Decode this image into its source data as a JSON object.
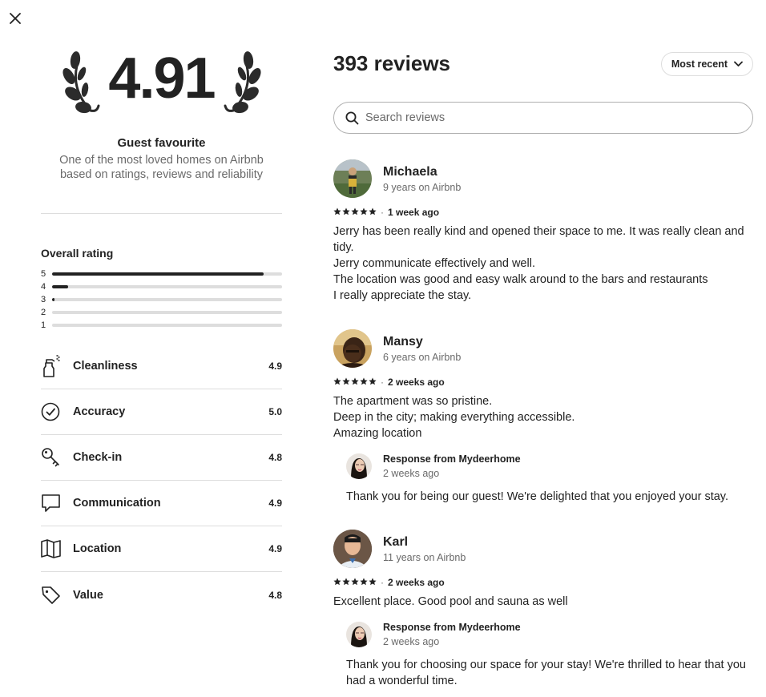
{
  "summary": {
    "rating": "4.91",
    "badge_title": "Guest favourite",
    "badge_desc_line1": "One of the most loved homes on Airbnb",
    "badge_desc_line2": "based on ratings, reviews and reliability"
  },
  "overall": {
    "title": "Overall rating",
    "distribution": [
      {
        "stars": "5",
        "fraction": 0.92
      },
      {
        "stars": "4",
        "fraction": 0.07
      },
      {
        "stars": "3",
        "fraction": 0.01
      },
      {
        "stars": "2",
        "fraction": 0.0
      },
      {
        "stars": "1",
        "fraction": 0.0
      }
    ]
  },
  "categories": [
    {
      "label": "Cleanliness",
      "score": "4.9",
      "icon": "spray-bottle-icon"
    },
    {
      "label": "Accuracy",
      "score": "5.0",
      "icon": "check-circle-icon"
    },
    {
      "label": "Check-in",
      "score": "4.8",
      "icon": "key-icon"
    },
    {
      "label": "Communication",
      "score": "4.9",
      "icon": "chat-bubble-icon"
    },
    {
      "label": "Location",
      "score": "4.9",
      "icon": "map-icon"
    },
    {
      "label": "Value",
      "score": "4.8",
      "icon": "tag-icon"
    }
  ],
  "reviews_header": {
    "count_label": "393 reviews",
    "sort_label": "Most recent",
    "search_placeholder": "Search reviews"
  },
  "reviews": [
    {
      "name": "Michaela",
      "since": "9 years on Airbnb",
      "stars": 5,
      "date": "1 week ago",
      "text_lines": [
        "Jerry has been really kind and opened their space to me. It was really clean and tidy.",
        "Jerry communicate effectively and well.",
        "The location was good and easy walk around to the bars and restaurants",
        "I really appreciate the stay."
      ]
    },
    {
      "name": "Mansy",
      "since": "6 years on Airbnb",
      "stars": 5,
      "date": "2 weeks ago",
      "text_lines": [
        "The apartment was so pristine.",
        "Deep in the city; making everything accessible.",
        "Amazing location"
      ],
      "response": {
        "title": "Response from Mydeerhome",
        "date": "2 weeks ago",
        "text": "Thank you for being our guest! We're delighted that you enjoyed your stay."
      }
    },
    {
      "name": "Karl",
      "since": "11 years on Airbnb",
      "stars": 5,
      "date": "2 weeks ago",
      "text_lines": [
        "Excellent place. Good pool and sauna as well"
      ],
      "response": {
        "title": "Response from Mydeerhome",
        "date": "2 weeks ago",
        "text": "Thank you for choosing our space for your stay! We're thrilled to hear that you had a wonderful time."
      }
    }
  ]
}
